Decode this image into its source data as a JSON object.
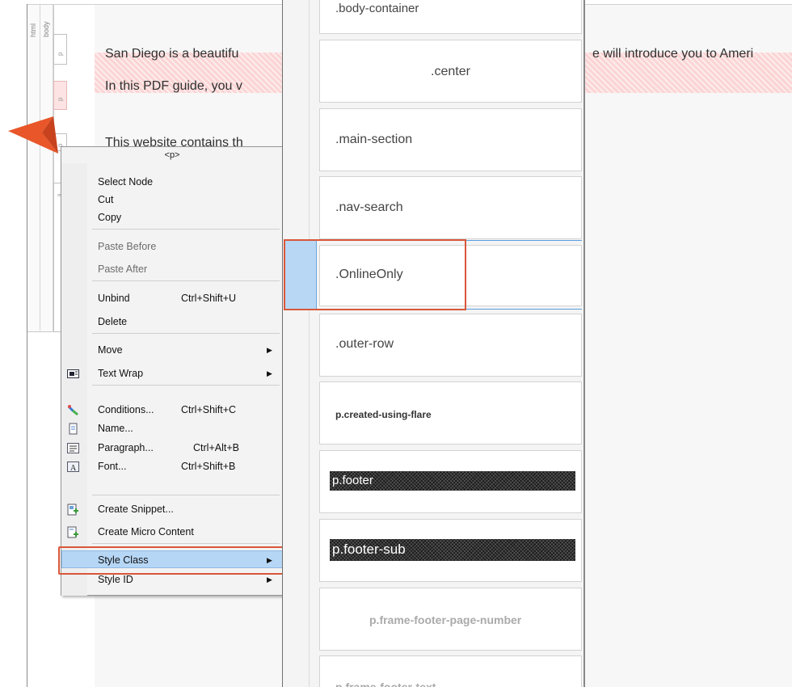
{
  "structure_bar": {
    "tags": [
      "html",
      "body"
    ],
    "para_tags": [
      "p",
      "p",
      "p",
      "li"
    ]
  },
  "document": {
    "para1_left": "San Diego is a beautifu",
    "para1_right": "e will introduce you to Ameri",
    "para2_left": "In this PDF guide, you v",
    "para3_left": "This website contains th"
  },
  "context_menu": {
    "header": "<p>",
    "items": [
      {
        "label": "Select Node",
        "shortcut": "",
        "disabled": false
      },
      {
        "label": "Cut",
        "shortcut": "",
        "disabled": false
      },
      {
        "label": "Copy",
        "shortcut": "",
        "disabled": false
      },
      {
        "label": "Paste Before",
        "shortcut": "",
        "disabled": true
      },
      {
        "label": "Paste After",
        "shortcut": "",
        "disabled": true
      },
      {
        "label": "Unbind",
        "shortcut": "Ctrl+Shift+U",
        "disabled": false
      },
      {
        "label": "Delete",
        "shortcut": "",
        "disabled": false
      },
      {
        "label": "Move",
        "shortcut": "",
        "submenu": true
      },
      {
        "label": "Text Wrap",
        "shortcut": "",
        "submenu": true,
        "icon": "text-wrap-icon"
      },
      {
        "label": "Conditions...",
        "shortcut": "Ctrl+Shift+C",
        "icon": "conditions-icon"
      },
      {
        "label": "Name...",
        "shortcut": "",
        "icon": "name-icon"
      },
      {
        "label": "Paragraph...",
        "shortcut": "Ctrl+Alt+B",
        "icon": "paragraph-icon"
      },
      {
        "label": "Font...",
        "shortcut": "Ctrl+Shift+B",
        "icon": "font-icon"
      },
      {
        "label": "Create Snippet...",
        "shortcut": "",
        "icon": "snippet-icon"
      },
      {
        "label": "Create Micro Content",
        "shortcut": "",
        "icon": "micro-content-icon"
      },
      {
        "label": "Style Class",
        "shortcut": "",
        "submenu": true,
        "active": true
      },
      {
        "label": "Style ID",
        "shortcut": "",
        "submenu": true
      }
    ]
  },
  "style_class_panel": {
    "top_partial": ".body-container",
    "classes": [
      ".center",
      ".main-section",
      ".nav-search",
      ".OnlineOnly",
      ".outer-row",
      "p.created-using-flare",
      "p.footer",
      "p.footer-sub",
      "p.frame-footer-page-number",
      "p.frame-footer-text"
    ],
    "selected": ".OnlineOnly"
  },
  "colors": {
    "highlight_red": "#d9573a",
    "menu_active": "#b6d6f5",
    "pointer_arrow": "#e8562a"
  }
}
